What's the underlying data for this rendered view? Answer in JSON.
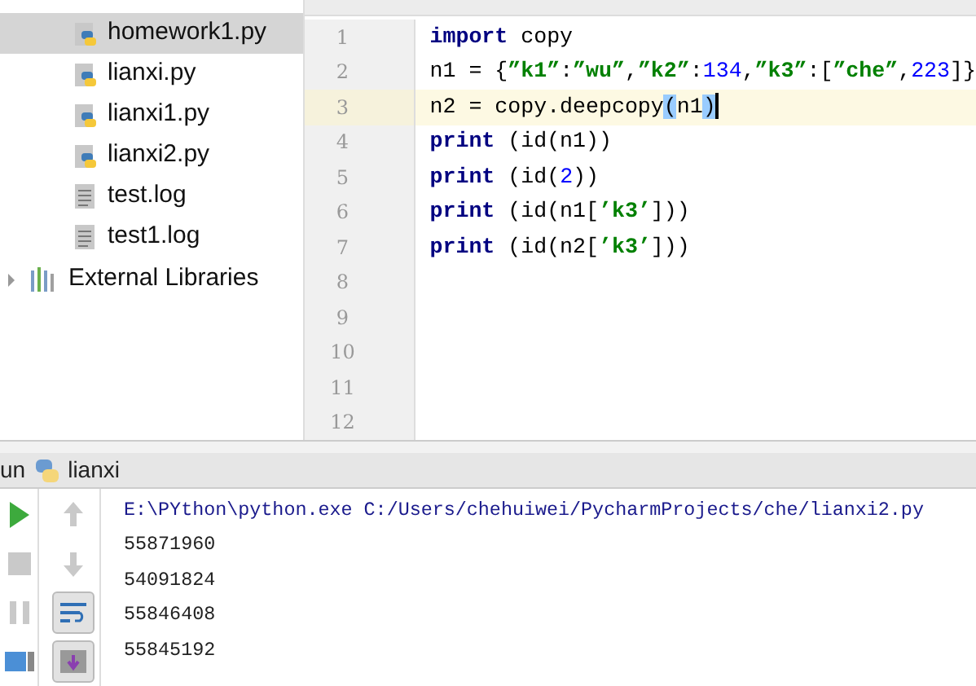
{
  "project_tree": {
    "items": [
      {
        "label": "homework1.py",
        "kind": "python",
        "selected": true
      },
      {
        "label": "lianxi.py",
        "kind": "python",
        "selected": false
      },
      {
        "label": "lianxi1.py",
        "kind": "python",
        "selected": false
      },
      {
        "label": "lianxi2.py",
        "kind": "python",
        "selected": false
      },
      {
        "label": "test.log",
        "kind": "log",
        "selected": false
      },
      {
        "label": "test1.log",
        "kind": "log",
        "selected": false
      }
    ],
    "external": {
      "label": "External Libraries",
      "expanded": false
    }
  },
  "editor": {
    "lines": [
      {
        "number": "1",
        "current": false,
        "tokens": [
          {
            "kind": "keyword",
            "text": "import"
          },
          {
            "kind": "plain",
            "text": " copy"
          }
        ]
      },
      {
        "number": "2",
        "current": false,
        "tokens": [
          {
            "kind": "plain",
            "text": "n1 = {"
          },
          {
            "kind": "string",
            "text": "”k1”"
          },
          {
            "kind": "plain",
            "text": ":"
          },
          {
            "kind": "string",
            "text": "”wu”"
          },
          {
            "kind": "plain",
            "text": ","
          },
          {
            "kind": "string",
            "text": "”k2”"
          },
          {
            "kind": "plain",
            "text": ":"
          },
          {
            "kind": "number",
            "text": "134"
          },
          {
            "kind": "plain",
            "text": ","
          },
          {
            "kind": "string",
            "text": "”k3”"
          },
          {
            "kind": "plain",
            "text": ":["
          },
          {
            "kind": "string",
            "text": "”che”"
          },
          {
            "kind": "plain",
            "text": ","
          },
          {
            "kind": "number",
            "text": "223"
          },
          {
            "kind": "plain",
            "text": "]}"
          }
        ]
      },
      {
        "number": "3",
        "current": true,
        "tokens": [
          {
            "kind": "plain",
            "text": "n2 = copy.deepcopy"
          },
          {
            "kind": "match",
            "text": "("
          },
          {
            "kind": "plain",
            "text": "n1"
          },
          {
            "kind": "match",
            "text": ")"
          }
        ],
        "cursor": true
      },
      {
        "number": "4",
        "current": false,
        "tokens": [
          {
            "kind": "keyword",
            "text": "print"
          },
          {
            "kind": "plain",
            "text": " (id(n1))"
          }
        ]
      },
      {
        "number": "5",
        "current": false,
        "tokens": [
          {
            "kind": "keyword",
            "text": "print"
          },
          {
            "kind": "plain",
            "text": " (id("
          },
          {
            "kind": "number",
            "text": "2"
          },
          {
            "kind": "plain",
            "text": "))"
          }
        ]
      },
      {
        "number": "6",
        "current": false,
        "tokens": [
          {
            "kind": "keyword",
            "text": "print"
          },
          {
            "kind": "plain",
            "text": " (id(n1["
          },
          {
            "kind": "string",
            "text": "’k3’"
          },
          {
            "kind": "plain",
            "text": "]))"
          }
        ]
      },
      {
        "number": "7",
        "current": false,
        "tokens": [
          {
            "kind": "keyword",
            "text": "print"
          },
          {
            "kind": "plain",
            "text": " (id(n2["
          },
          {
            "kind": "string",
            "text": "’k3’"
          },
          {
            "kind": "plain",
            "text": "]))"
          }
        ]
      },
      {
        "number": "8",
        "current": false
      },
      {
        "number": "9",
        "current": false
      },
      {
        "number": "10",
        "current": false
      },
      {
        "number": "11",
        "current": false
      },
      {
        "number": "12",
        "current": false
      }
    ]
  },
  "run_panel": {
    "title": "un",
    "config": "lianxi",
    "tools_left": [
      {
        "kind": "run",
        "disabled": false
      },
      {
        "kind": "stop",
        "disabled": true
      },
      {
        "kind": "pause",
        "disabled": true
      },
      {
        "kind": "layout",
        "disabled": false
      }
    ],
    "tools_right": [
      {
        "kind": "up",
        "disabled": true,
        "on": false
      },
      {
        "kind": "down",
        "disabled": true,
        "on": false
      },
      {
        "kind": "wrap",
        "disabled": false,
        "on": true
      },
      {
        "kind": "scroll-end",
        "disabled": false,
        "on": true
      }
    ],
    "output": [
      {
        "kind": "command",
        "text": "E:\\PYthon\\python.exe C:/Users/chehuiwei/PycharmProjects/che/lianxi2.py"
      },
      {
        "kind": "stdout",
        "text": "55871960"
      },
      {
        "kind": "stdout",
        "text": "54091824"
      },
      {
        "kind": "stdout",
        "text": "55846408"
      },
      {
        "kind": "stdout",
        "text": "55845192"
      }
    ]
  }
}
